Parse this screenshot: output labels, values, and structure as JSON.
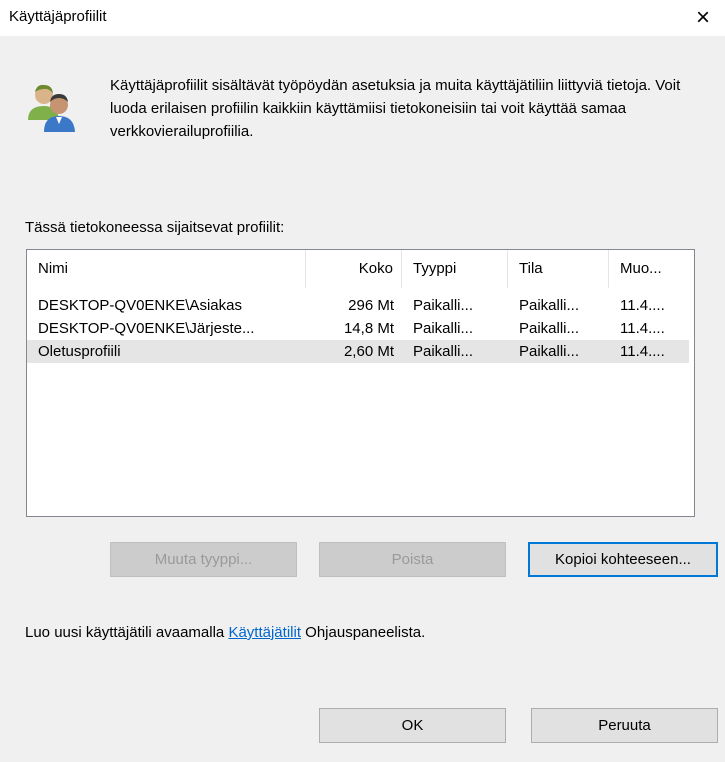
{
  "window": {
    "title": "Käyttäjäprofiilit",
    "close_glyph": "×"
  },
  "description": "Käyttäjäprofiilit sisältävät työpöydän asetuksia ja muita käyttäjätiliin liittyviä tietoja. Voit luoda erilaisen profiilin kaikkiin käyttämiisi tietokoneisiin tai voit käyttää samaa verkkovierailuprofiilia.",
  "profiles_label": "Tässä tietokoneessa sijaitsevat profiilit:",
  "columns": [
    "Nimi",
    "Koko",
    "Tyyppi",
    "Tila",
    "Muo..."
  ],
  "rows": [
    [
      "DESKTOP-QV0ENKE\\Asiakas",
      "296 Mt",
      "Paikalli...",
      "Paikalli...",
      "11.4...."
    ],
    [
      "DESKTOP-QV0ENKE\\Järjeste...",
      "14,8 Mt",
      "Paikalli...",
      "Paikalli...",
      "11.4...."
    ],
    [
      "Oletusprofiili",
      "2,60 Mt",
      "Paikalli...",
      "Paikalli...",
      "11.4...."
    ]
  ],
  "buttons": {
    "change_type": "Muuta tyyppi...",
    "delete": "Poista",
    "copy_to": "Kopioi kohteeseen...",
    "ok": "OK",
    "cancel": "Peruuta"
  },
  "footer": {
    "prefix": "Luo uusi käyttäjätili avaamalla ",
    "link": "Käyttäjätilit",
    "suffix": " Ohjauspaneelista."
  },
  "icons": {
    "avatar": "users-icon",
    "close": "close-icon"
  },
  "colors": {
    "link": "#0066cc",
    "selected_row": "#e5e5e5",
    "focus_border": "#0078d7"
  }
}
